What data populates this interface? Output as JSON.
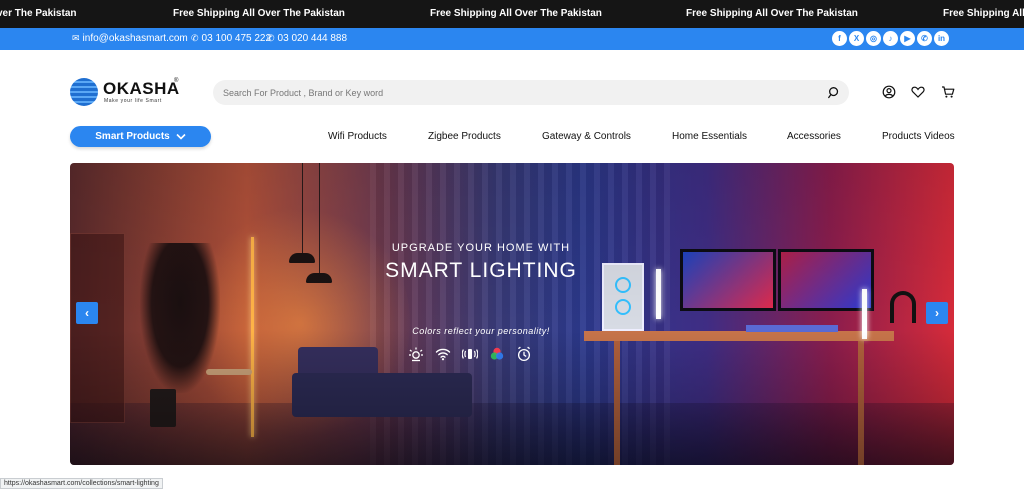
{
  "marquee": {
    "items": [
      "ver The Pakistan",
      "Free Shipping All Over The Pakistan",
      "Free Shipping All Over The Pakistan",
      "Free Shipping All Over The Pakistan",
      "Free Shipping All O"
    ]
  },
  "contact": {
    "email": "info@okashasmart.com",
    "phone_1": "03 100 475 222",
    "phone_2": "03 020 444 888",
    "socials": [
      "facebook-icon",
      "x-icon",
      "instagram-icon",
      "tiktok-icon",
      "youtube-icon",
      "whatsapp-icon",
      "linkedin-icon"
    ],
    "social_glyphs": [
      "f",
      "X",
      "◎",
      "♪",
      "▶",
      "✆",
      "in"
    ]
  },
  "header": {
    "logo_name": "OKASHA",
    "logo_reg": "®",
    "logo_tagline": "Make your life Smart",
    "search_placeholder": "Search For Product , Brand or Key word"
  },
  "nav": {
    "category_button": "Smart Products",
    "links": [
      "Wifi Products",
      "Zigbee Products",
      "Gateway & Controls",
      "Home Essentials",
      "Accessories",
      "Products Videos"
    ]
  },
  "banner": {
    "subtitle": "UPGRADE YOUR HOME WITH",
    "title": "SMART LIGHTING",
    "tagline": "Colors reflect your personality!",
    "features": [
      "brightness-icon",
      "wifi-icon",
      "sound-icon",
      "color-icon",
      "timer-icon"
    ],
    "prev_glyph": "‹",
    "next_glyph": "›"
  },
  "status_bar": {
    "url": "https://okashasmart.com/collections/smart-lighting"
  },
  "colors": {
    "accent": "#2b86f0",
    "marquee_bg": "#151515"
  }
}
